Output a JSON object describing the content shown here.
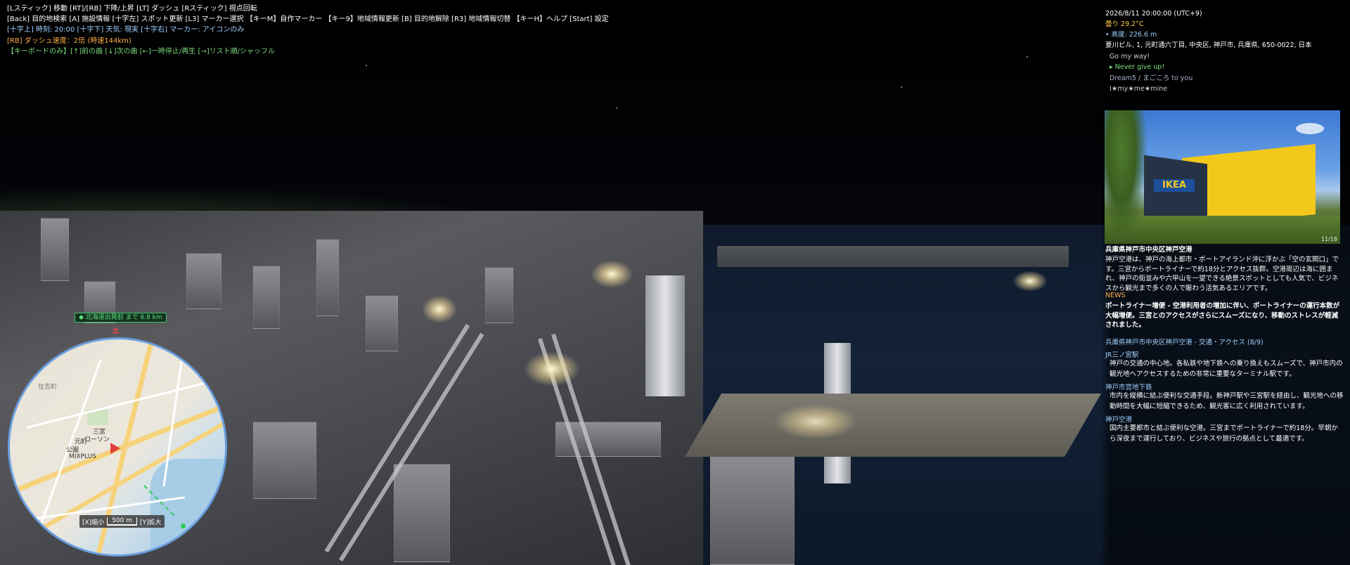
{
  "hud": {
    "line1": "[Lスティック] 移動 [RT]/[RB] 下降/上昇 [LT] ダッシュ [Rスティック] 視点回転",
    "line2": "[Back] 目的地検索 [A] 施設情報 [十字左] スポット更新 [L3] マーカー選択 【キーM】自作マーカー 【キー9】地域情報更新 [B] 目的地解除 [R3] 地域情報切替 【キーH】ヘルプ [Start] 設定",
    "line3": "[十字上] 時刻: 20:00 [十字下] 天気: 現実 [十字右] マーカー: アイコンのみ",
    "line4": "[RB] ダッシュ速度：2倍 (時速144km)",
    "line5": "【キーボードのみ】[↑]前の曲 [↓]次の曲 [←]一時停止/再生 [→]リスト順/シャッフル"
  },
  "panel": {
    "datetime": "2026/8/11 20:00:00 (UTC+9)",
    "weather": "曇り 29.2°C",
    "altitude": "• 高度: 226.6 m",
    "address": "菱川ビル, 1, 元町通六丁目, 中央区, 神戸市, 兵庫県, 650-0022, 日本",
    "songs": [
      {
        "title": "Go my way!"
      },
      {
        "title": "▸ Never give up!"
      },
      {
        "title": "Dream5 / まごころ to you"
      },
      {
        "title": "I★my★me★mine"
      }
    ],
    "photo_index": "11/18",
    "photo_sign": "IKEA",
    "area_title": "兵庫県神戸市中央区神戸空港",
    "area_desc": "神戸空港は、神戸の海上都市・ポートアイランド沖に浮かぶ「空の玄関口」です。三宮からポートライナーで約18分とアクセス抜群。空港周辺は海に囲まれ、神戸の街並みや六甲山を一望できる絶景スポットとしても人気で、ビジネスから観光まで多くの人で賑わう活気あるエリアです。",
    "news_label": "NEWS",
    "news_body": "ポートライナー増便 - 空港利用者の増加に伴い、ポートライナーの運行本数が大幅増便。三宮とのアクセスがさらにスムーズになり、移動のストレスが軽減されました。",
    "access_head": "兵庫県神戸市中央区神戸空港 - 交通・アクセス (8/9)",
    "access": [
      {
        "name": "JR三ノ宮駅",
        "desc": "神戸の交通の中心地。各私鉄や地下鉄への乗り換えもスムーズで、神戸市内の観光地へアクセスするための非常に重要なターミナル駅です。"
      },
      {
        "name": "神戸市営地下鉄",
        "desc": "市内を縦横に結ぶ便利な交通手段。新神戸駅や三宮駅を経由し、観光地への移動時間を大幅に短縮できるため、観光客に広く利用されています。"
      },
      {
        "name": "神戸空港",
        "desc": "国内主要都市と結ぶ便利な空港。三宮までポートライナーで約18分。早朝から深夜まで運行しており、ビジネスや旅行の拠点として最適です。"
      }
    ]
  },
  "destination": {
    "label": "◆ 北海道出発前 まで 6.8 km"
  },
  "minimap": {
    "north": "北",
    "labels": [
      "三宮",
      "元町",
      "ローソン",
      "公園",
      "MIXPLUS",
      "住吉町"
    ],
    "zoom_out": "[X]縮小",
    "scale": "500 m",
    "zoom_in": "[Y]拡大",
    "road_color": "#f6d27a",
    "water_color": "#a6cce6",
    "player_color": "#e04040",
    "route_color": "#2ecc55"
  }
}
